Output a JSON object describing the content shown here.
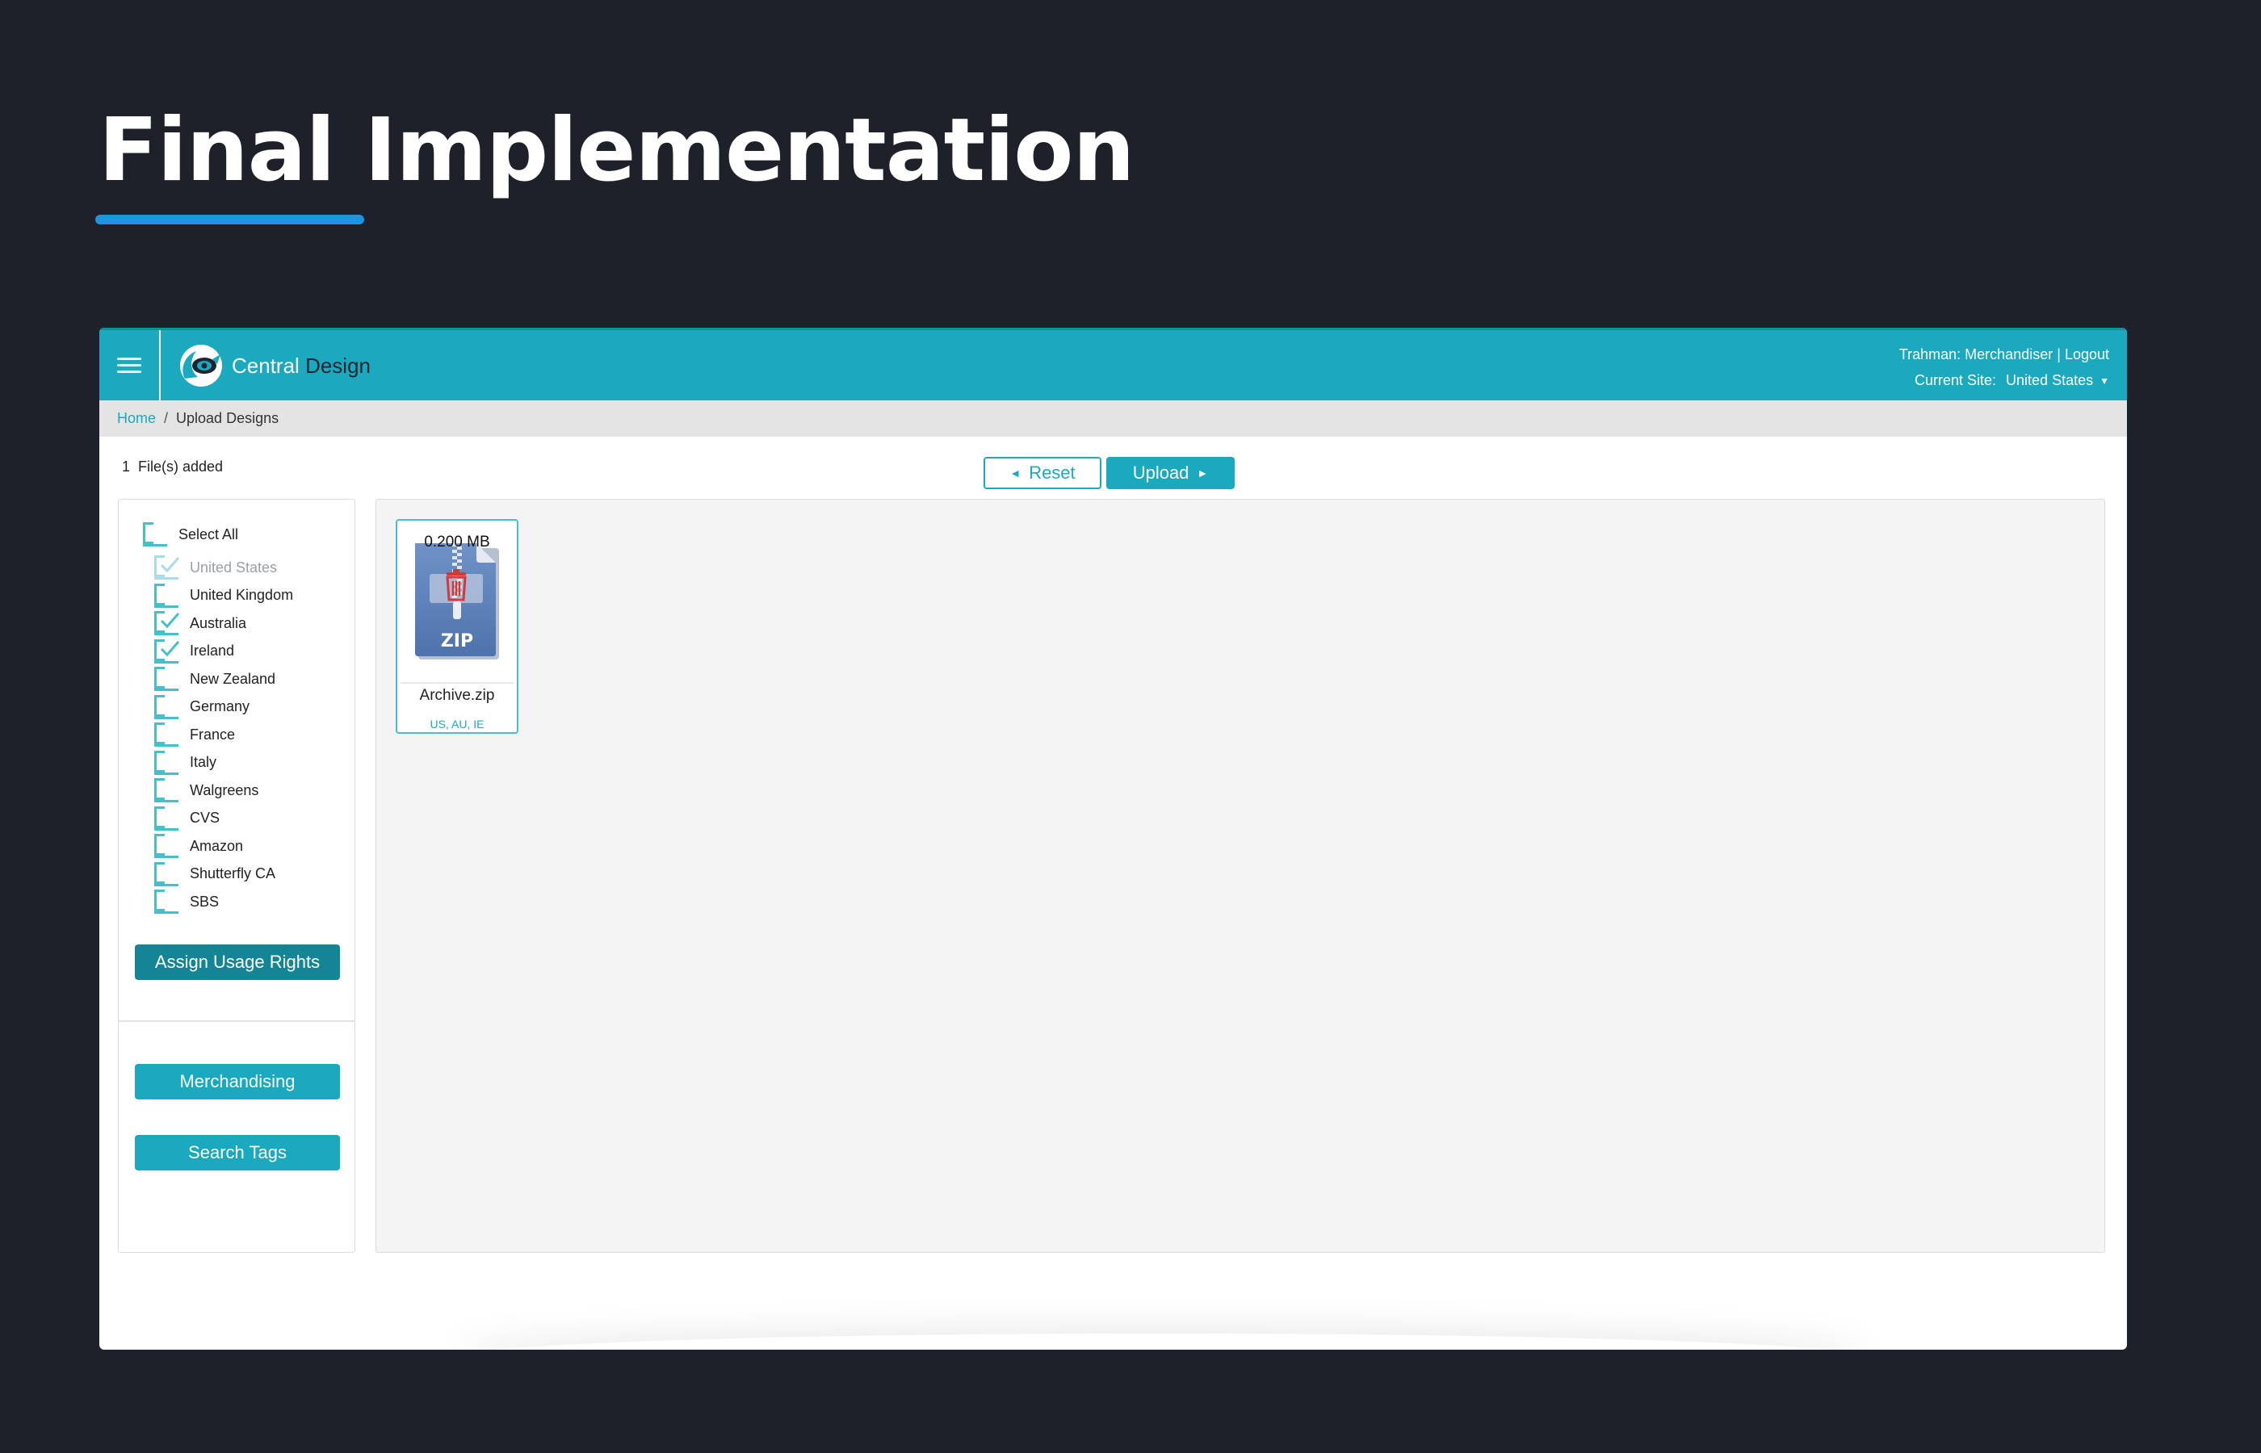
{
  "slide": {
    "title": "Final Implementation"
  },
  "header": {
    "brand_part1": "Central",
    "brand_part2": "Design",
    "user": "Trahman: Merchandiser",
    "separator": "|",
    "logout": "Logout",
    "current_site_label": "Current Site:",
    "current_site_value": "United States"
  },
  "breadcrumb": {
    "home": "Home",
    "separator": "/",
    "current": "Upload Designs"
  },
  "toolbar": {
    "files_count": "1",
    "files_label": "File(s) added",
    "reset_label": "Reset",
    "upload_label": "Upload"
  },
  "sidebar": {
    "select_all": {
      "label": "Select All",
      "checked": false
    },
    "sites": [
      {
        "label": "United States",
        "checked": true,
        "disabled": true
      },
      {
        "label": "United Kingdom",
        "checked": false
      },
      {
        "label": "Australia",
        "checked": true
      },
      {
        "label": "Ireland",
        "checked": true
      },
      {
        "label": "New Zealand",
        "checked": false
      },
      {
        "label": "Germany",
        "checked": false
      },
      {
        "label": "France",
        "checked": false
      },
      {
        "label": "Italy",
        "checked": false
      },
      {
        "label": "Walgreens",
        "checked": false
      },
      {
        "label": "CVS",
        "checked": false
      },
      {
        "label": "Amazon",
        "checked": false
      },
      {
        "label": "Shutterfly CA",
        "checked": false
      },
      {
        "label": "SBS",
        "checked": false
      }
    ],
    "assign_label": "Assign Usage Rights",
    "merch_label": "Merchandising",
    "tags_label": "Search Tags"
  },
  "file": {
    "size": "0.200 MB",
    "type_badge": "ZIP",
    "name": "Archive.zip",
    "sites": "US, AU, IE"
  },
  "colors": {
    "background": "#1e202a",
    "accent": "#1aa9bf",
    "accent_dark": "#148594",
    "underline": "#1e93e0",
    "checkbox": "#45bfcc",
    "delete": "#d23a3a",
    "zip": "#5a7db5"
  },
  "icons": {
    "menu": "hamburger-menu-icon",
    "brand": "central-design-logo",
    "caret": "caret-down-icon",
    "reset_arrow": "arrow-left-icon",
    "upload_arrow": "arrow-right-icon",
    "file": "zip-file-icon",
    "delete": "trash-icon",
    "checkmark": "checkmark-icon"
  }
}
